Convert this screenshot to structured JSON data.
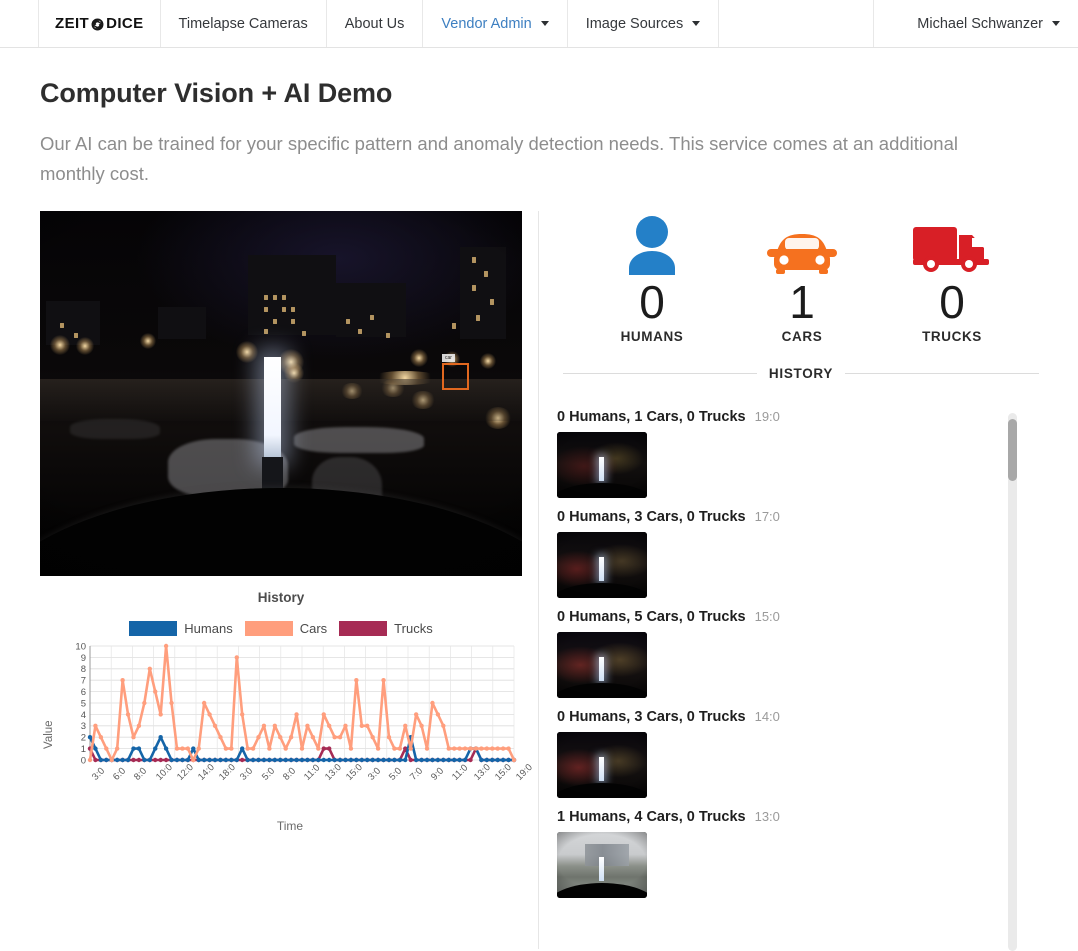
{
  "navbar": {
    "brand_left": "ZEIT",
    "brand_right": "DICE",
    "brand_icon": "camera-aperture-icon",
    "items": [
      {
        "label": "Timelapse Cameras",
        "has_caret": false,
        "active": false
      },
      {
        "label": "About Us",
        "has_caret": false,
        "active": false
      },
      {
        "label": "Vendor Admin",
        "has_caret": true,
        "active": true
      },
      {
        "label": "Image Sources",
        "has_caret": true,
        "active": false
      }
    ],
    "user": {
      "label": "Michael Schwanzer",
      "has_caret": true
    },
    "active_color": "#3d7fc1"
  },
  "page": {
    "title": "Computer Vision + AI Demo",
    "subtitle": "Our AI can be trained for your specific pattern and anomaly detection needs. This service comes at an additional monthly cost."
  },
  "camera": {
    "detection_label": "car",
    "scene": "night-street-camera"
  },
  "counters": [
    {
      "icon": "person-icon",
      "value": "0",
      "label": "HUMANS",
      "color": "#2480c8"
    },
    {
      "icon": "car-icon",
      "value": "1",
      "label": "CARS",
      "color": "#f5711f"
    },
    {
      "icon": "truck-icon",
      "value": "0",
      "label": "TRUCKS",
      "color": "#d81f26"
    }
  ],
  "history": {
    "heading": "HISTORY",
    "entries": [
      {
        "text": "0 Humans, 1 Cars, 0 Trucks",
        "time": "19:0",
        "thumb": "night"
      },
      {
        "text": "0 Humans, 3 Cars, 0 Trucks",
        "time": "17:0",
        "thumb": "night"
      },
      {
        "text": "0 Humans, 5 Cars, 0 Trucks",
        "time": "15:0",
        "thumb": "night"
      },
      {
        "text": "0 Humans, 3 Cars, 0 Trucks",
        "time": "14:0",
        "thumb": "night"
      },
      {
        "text": "1 Humans, 4 Cars, 0 Trucks",
        "time": "13:0",
        "thumb": "day"
      }
    ]
  },
  "chart_data": {
    "type": "line",
    "title": "History",
    "xlabel": "Time",
    "ylabel": "Value",
    "ylim": [
      0,
      10
    ],
    "yticks": [
      0,
      1,
      2,
      3,
      4,
      5,
      6,
      7,
      8,
      9,
      10
    ],
    "grid": true,
    "legend_position": "top",
    "xtick_labels": [
      "3:0",
      "6:0",
      "8:0",
      "10:0",
      "12:0",
      "14:0",
      "18:0",
      "3:0",
      "5:0",
      "8:0",
      "11:0",
      "13:0",
      "15:0",
      "3:0",
      "5:0",
      "7:0",
      "9:0",
      "11:0",
      "13:0",
      "15:0",
      "19:0"
    ],
    "series": [
      {
        "name": "Humans",
        "color": "#1565A8",
        "values": [
          2,
          1,
          0,
          0,
          0,
          0,
          0,
          0,
          1,
          1,
          0,
          0,
          1,
          2,
          1,
          0,
          0,
          0,
          0,
          1,
          0,
          0,
          0,
          0,
          0,
          0,
          0,
          0,
          1,
          0,
          0,
          0,
          0,
          0,
          0,
          0,
          0,
          0,
          0,
          0,
          0,
          0,
          0,
          0,
          0,
          0,
          0,
          0,
          0,
          0,
          0,
          0,
          0,
          0,
          0,
          0,
          0,
          0,
          0,
          2,
          0,
          0,
          0,
          0,
          0,
          0,
          0,
          0,
          0,
          0,
          1,
          1,
          0,
          0,
          0,
          0,
          0,
          0,
          0
        ]
      },
      {
        "name": "Cars",
        "color": "#FF9E7D",
        "values": [
          0,
          3,
          2,
          1,
          0,
          1,
          7,
          4,
          2,
          3,
          5,
          8,
          6,
          4,
          10,
          5,
          1,
          1,
          1,
          0,
          1,
          5,
          4,
          3,
          2,
          1,
          1,
          9,
          4,
          1,
          1,
          2,
          3,
          1,
          3,
          2,
          1,
          2,
          4,
          1,
          3,
          2,
          1,
          4,
          3,
          2,
          2,
          3,
          1,
          7,
          3,
          3,
          2,
          1,
          7,
          2,
          1,
          1,
          3,
          1,
          4,
          3,
          1,
          5,
          4,
          3,
          1,
          1,
          1,
          1,
          1,
          1,
          1,
          1,
          1,
          1,
          1,
          1,
          0
        ]
      },
      {
        "name": "Trucks",
        "color": "#A62B54",
        "values": [
          1,
          0,
          0,
          0,
          0,
          0,
          0,
          0,
          0,
          0,
          0,
          0,
          0,
          0,
          0,
          0,
          0,
          0,
          0,
          0,
          0,
          0,
          0,
          0,
          0,
          0,
          0,
          0,
          0,
          0,
          0,
          0,
          0,
          0,
          0,
          0,
          0,
          0,
          0,
          0,
          0,
          0,
          0,
          1,
          1,
          0,
          0,
          0,
          0,
          0,
          0,
          0,
          0,
          0,
          0,
          0,
          0,
          0,
          1,
          0,
          0,
          0,
          0,
          0,
          0,
          0,
          0,
          0,
          0,
          0,
          0,
          1,
          0,
          0,
          0,
          0,
          0,
          0,
          0
        ]
      }
    ]
  }
}
